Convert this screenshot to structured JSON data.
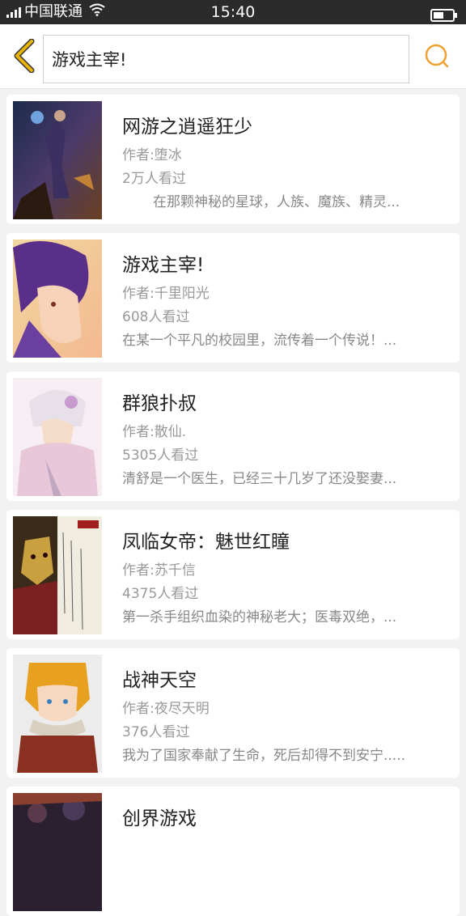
{
  "status_bar": {
    "carrier": "中国联通",
    "time": "15:40"
  },
  "header": {
    "search_value": "游戏主宰!",
    "search_placeholder": ""
  },
  "colors": {
    "accent": "#f0a030",
    "back_icon": "#e8b400"
  },
  "books": [
    {
      "title": "网游之逍遥狂少",
      "author": "作者:堕冰",
      "views": "2万人看过",
      "desc": "在那颗神秘的星球，人族、魔族、精灵..."
    },
    {
      "title": "游戏主宰!",
      "author": "作者:千里阳光",
      "views": "608人看过",
      "desc": "在某一个平凡的校园里，流传着一个传说！..."
    },
    {
      "title": "群狼扑叔",
      "author": "作者:散仙.",
      "views": "5305人看过",
      "desc": "清舒是一个医生，已经三十几岁了还没娶妻..."
    },
    {
      "title": "凤临女帝：魅世红瞳",
      "author": "作者:苏千信",
      "views": "4375人看过",
      "desc": "第一杀手组织血染的神秘老大；医毒双绝，..."
    },
    {
      "title": "战神天空",
      "author": "作者:夜尽天明",
      "views": "376人看过",
      "desc": "我为了国家奉献了生命，死后却得不到安宁....."
    },
    {
      "title": "创界游戏",
      "author": "",
      "views": "",
      "desc": ""
    }
  ]
}
